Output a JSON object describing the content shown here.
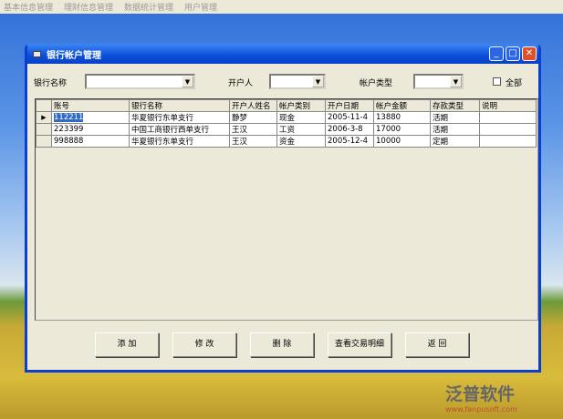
{
  "menu": [
    "基本信息管理",
    "理财信息管理",
    "数据统计管理",
    "用户管理"
  ],
  "window": {
    "title": "银行帐户管理",
    "min": "_",
    "max": "□",
    "close": "✕"
  },
  "filters": {
    "bank_label": "银行名称",
    "bank_value": "",
    "owner_label": "开户人",
    "owner_value": "",
    "type_label": "帐户类型",
    "type_value": "",
    "all_label": "全部"
  },
  "grid": {
    "columns": [
      "账号",
      "银行名称",
      "开户人姓名",
      "帐户类别",
      "开户日期",
      "帐户金额",
      "存款类型",
      "说明"
    ],
    "rows": [
      [
        "112211",
        "华夏银行东单支行",
        "静梦",
        "现金",
        "2005-11-4",
        "13880",
        "活期",
        ""
      ],
      [
        "223399",
        "中国工商银行西单支行",
        "王汉",
        "工资",
        "2006-3-8",
        "17000",
        "活期",
        ""
      ],
      [
        "998888",
        "华夏银行东单支行",
        "王汉",
        "资金",
        "2005-12-4",
        "10000",
        "定期",
        ""
      ]
    ]
  },
  "buttons": {
    "add": "添 加",
    "edit": "修 改",
    "delete": "删 除",
    "details": "查看交易明细",
    "back": "返 回"
  },
  "watermark": {
    "brand": "泛普软件",
    "site": "www.fanpusoft.com"
  }
}
